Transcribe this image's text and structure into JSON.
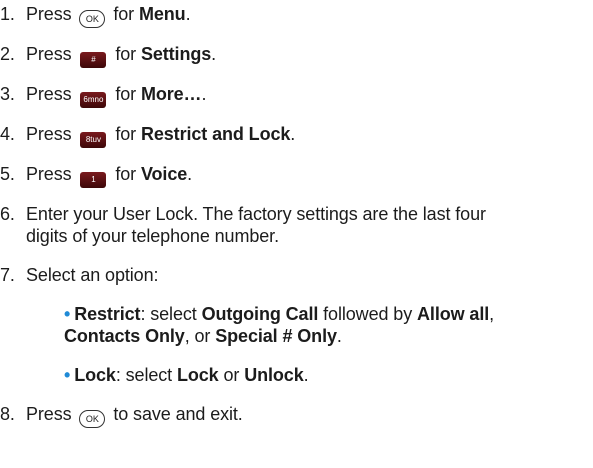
{
  "steps": [
    {
      "num": "1.",
      "pre": "Press",
      "key": "OK",
      "mid": "for",
      "target": "Menu",
      "post": "."
    },
    {
      "num": "2.",
      "pre": "Press",
      "key": "#",
      "mid": "for",
      "target": "Settings",
      "post": "."
    },
    {
      "num": "3.",
      "pre": "Press",
      "key": "6mno",
      "mid": "for",
      "target": "More…",
      "post": "."
    },
    {
      "num": "4.",
      "pre": "Press",
      "key": "8tuv",
      "mid": "for",
      "target": "Restrict and Lock",
      "post": "."
    },
    {
      "num": "5.",
      "pre": "Press",
      "key": "1",
      "mid": "for",
      "target": "Voice",
      "post": "."
    }
  ],
  "step6": {
    "num": "6.",
    "line1": "Enter your User Lock. The factory settings are the last four",
    "line2": "digits of your telephone number."
  },
  "step7": {
    "num": "7.",
    "text": "Select an option:",
    "bullets": [
      {
        "term": "Restrict",
        "t1": ": select ",
        "b1": "Outgoing Call",
        "t2": " followed by ",
        "b2": "Allow all",
        "t3": ",",
        "b3": "Contacts Only",
        "t4": ", or ",
        "b4": "Special # Only",
        "t5": "."
      },
      {
        "term": "Lock",
        "t1": ": select ",
        "b1": "Lock",
        "t2": " or ",
        "b2": "Unlock",
        "t3": "."
      }
    ]
  },
  "step8": {
    "num": "8.",
    "pre": "Press",
    "key": "OK",
    "post": "to save and exit."
  }
}
